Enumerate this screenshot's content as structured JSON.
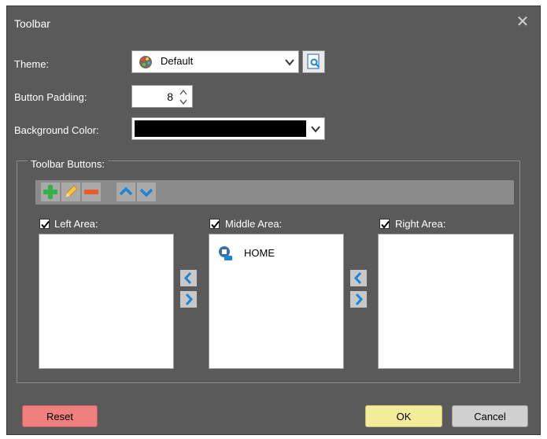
{
  "window": {
    "title": "Toolbar",
    "close_label": "✕"
  },
  "form": {
    "theme_label": "Theme:",
    "theme_value": "Default",
    "button_padding_label": "Button Padding:",
    "button_padding_value": "8",
    "background_color_label": "Background Color:",
    "background_color_value": "#000000"
  },
  "toolbar_buttons": {
    "group_title": "Toolbar Buttons:",
    "actions": [
      "add",
      "edit",
      "remove",
      "move-up",
      "move-down"
    ],
    "areas": [
      {
        "label": "Left Area:",
        "checked": true,
        "items": []
      },
      {
        "label": "Middle Area:",
        "checked": true,
        "items": [
          {
            "icon": "home-badge-icon",
            "label": "HOME"
          }
        ]
      },
      {
        "label": "Right Area:",
        "checked": true,
        "items": []
      }
    ]
  },
  "footer": {
    "reset_label": "Reset",
    "ok_label": "OK",
    "cancel_label": "Cancel"
  },
  "colors": {
    "dialog_bg": "#5a5a5a",
    "reset_bg": "#f08080",
    "ok_bg": "#f3ec9a",
    "cancel_bg": "#d0d0d0",
    "accent_blue": "#1a86d8"
  }
}
